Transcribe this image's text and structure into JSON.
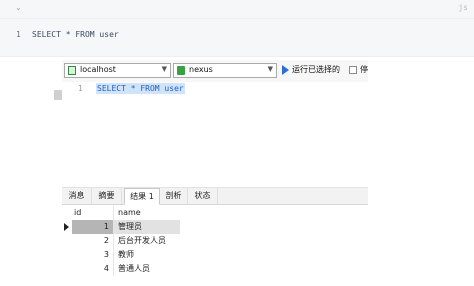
{
  "code_block": {
    "line_number": "1",
    "code": "SELECT * FROM user",
    "lang_label": "js"
  },
  "toolbar": {
    "connection": "localhost",
    "database": "nexus",
    "run_label": "运行已选择的",
    "checkbox_label": "停"
  },
  "editor": {
    "line_number": "1",
    "sql": "SELECT * FROM user"
  },
  "tabs": [
    {
      "label": "消息"
    },
    {
      "label": "摘要"
    },
    {
      "label": "结果 1"
    },
    {
      "label": "剖析"
    },
    {
      "label": "状态"
    }
  ],
  "result": {
    "columns": [
      "id",
      "name"
    ],
    "rows": [
      {
        "id": "1",
        "name": "管理员"
      },
      {
        "id": "2",
        "name": "后台开发人员"
      },
      {
        "id": "3",
        "name": "教师"
      },
      {
        "id": "4",
        "name": "普通人员"
      }
    ]
  }
}
